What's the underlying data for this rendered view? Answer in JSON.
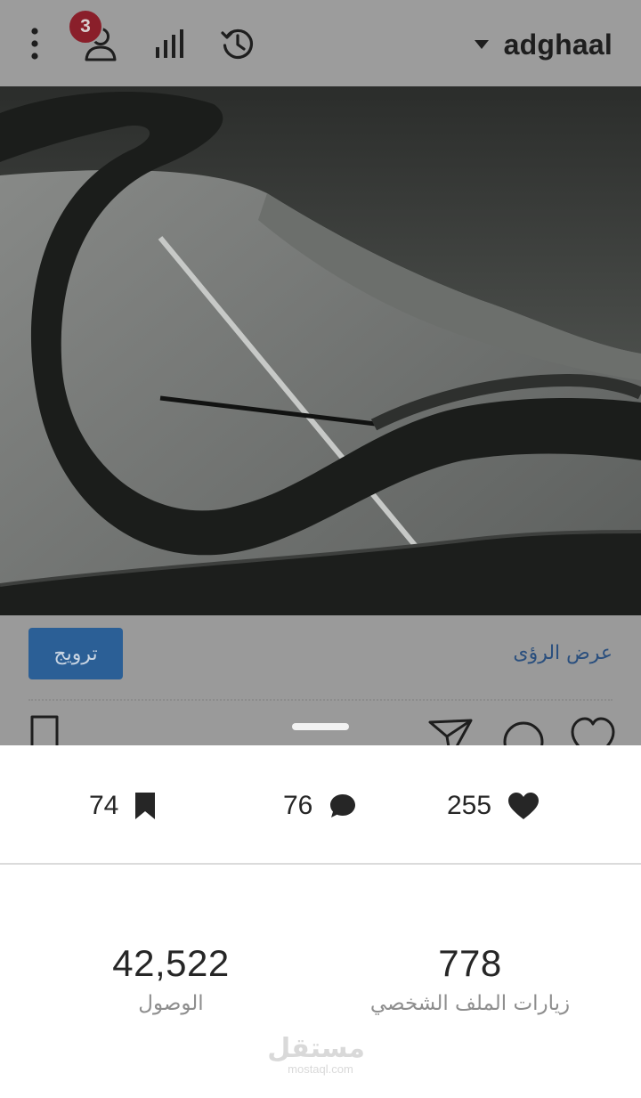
{
  "header": {
    "notification_count": "3",
    "account_name": "adghaal",
    "icons": [
      "more-vertical-icon",
      "profile-icon",
      "insights-bar-chart-icon",
      "activity-history-icon",
      "chevron-down-icon"
    ]
  },
  "post": {
    "media_description": "video-thumbnail",
    "promote_label": "ترويج",
    "view_insights_label": "عرض الرؤى"
  },
  "insights": {
    "saves": "74",
    "comments": "76",
    "likes": "255",
    "reach_value": "42,522",
    "reach_label": "الوصول",
    "profile_visits_value": "778",
    "profile_visits_label": "زيارات الملف الشخصي"
  },
  "watermark": {
    "mark": "مستقل",
    "url": "mostaql.com"
  },
  "colors": {
    "overlay_gray": "#9c9c9c",
    "badge_red": "#8a1f2a",
    "promote_blue": "#2b5f96",
    "link_blue": "#2a4f7e",
    "text_dark": "#262626",
    "text_muted": "#8e8e8e"
  }
}
